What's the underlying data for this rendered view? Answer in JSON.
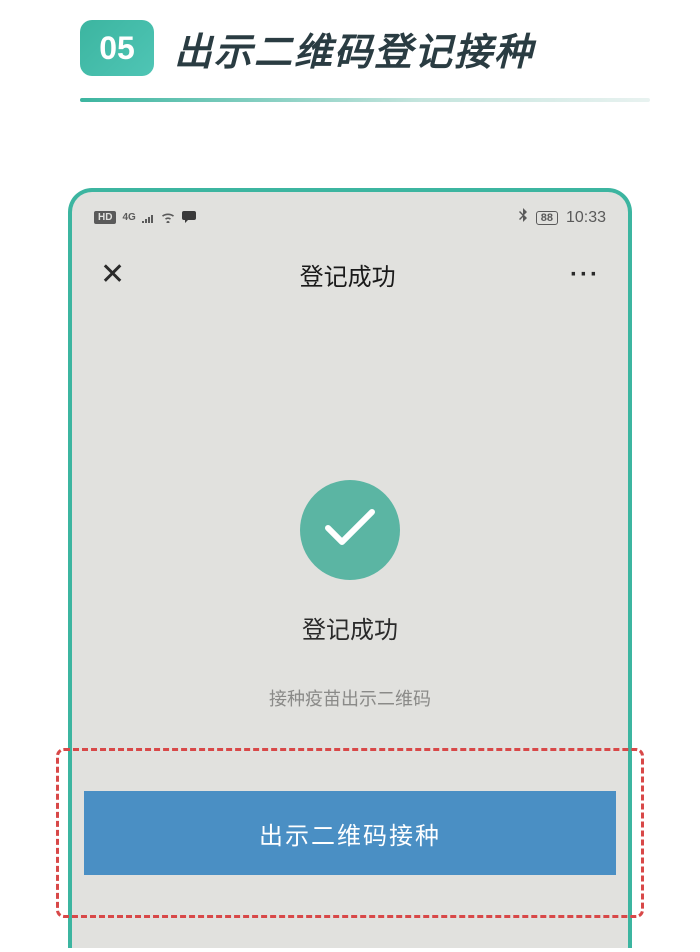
{
  "step": {
    "number": "05",
    "title": "出示二维码登记接种"
  },
  "statusBar": {
    "hd": "HD",
    "network": "4G",
    "battery": "88",
    "time": "10:33"
  },
  "appNav": {
    "title": "登记成功"
  },
  "content": {
    "successTitle": "登记成功",
    "successSubtitle": "接种疫苗出示二维码",
    "buttonLabel": "出示二维码接种"
  }
}
